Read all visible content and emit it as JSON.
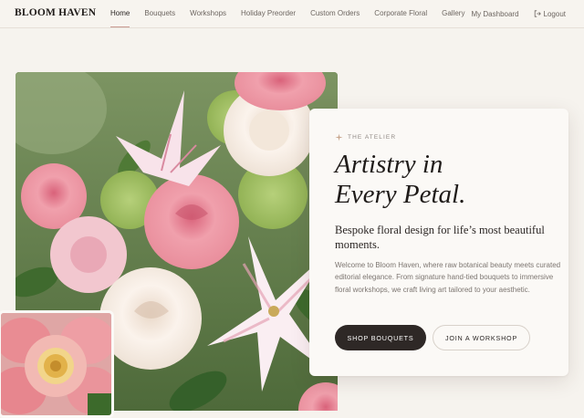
{
  "header": {
    "brand": "BLOOM HAVEN",
    "nav": [
      {
        "label": "Home",
        "active": true
      },
      {
        "label": "Bouquets",
        "active": false
      },
      {
        "label": "Workshops",
        "active": false
      },
      {
        "label": "Holiday Preorder",
        "active": false
      },
      {
        "label": "Custom Orders",
        "active": false
      },
      {
        "label": "Corporate Floral",
        "active": false
      },
      {
        "label": "Gallery",
        "active": false
      }
    ],
    "dashboard": "My Dashboard",
    "logout": "Logout"
  },
  "hero": {
    "eyebrow": "THE ATELIER",
    "headline_line1": "Artistry in",
    "headline_line2": "Every Petal.",
    "subhead": "Bespoke floral design for life’s most beautiful moments.",
    "body": "Welcome to Bloom Haven, where raw botanical beauty meets curated editorial elegance. From signature hand-tied bouquets to immersive floral workshops, we craft living art tailored to your aesthetic.",
    "primary_cta": "SHOP BOUQUETS",
    "secondary_cta": "JOIN A WORKSHOP"
  },
  "icons": {
    "logout": "logout-icon",
    "eyebrow": "sparkle-icon"
  },
  "colors": {
    "background": "#f6f3ee",
    "accent": "#c99a92",
    "primary_button": "#2e2826",
    "ink": "#1f1b19"
  }
}
